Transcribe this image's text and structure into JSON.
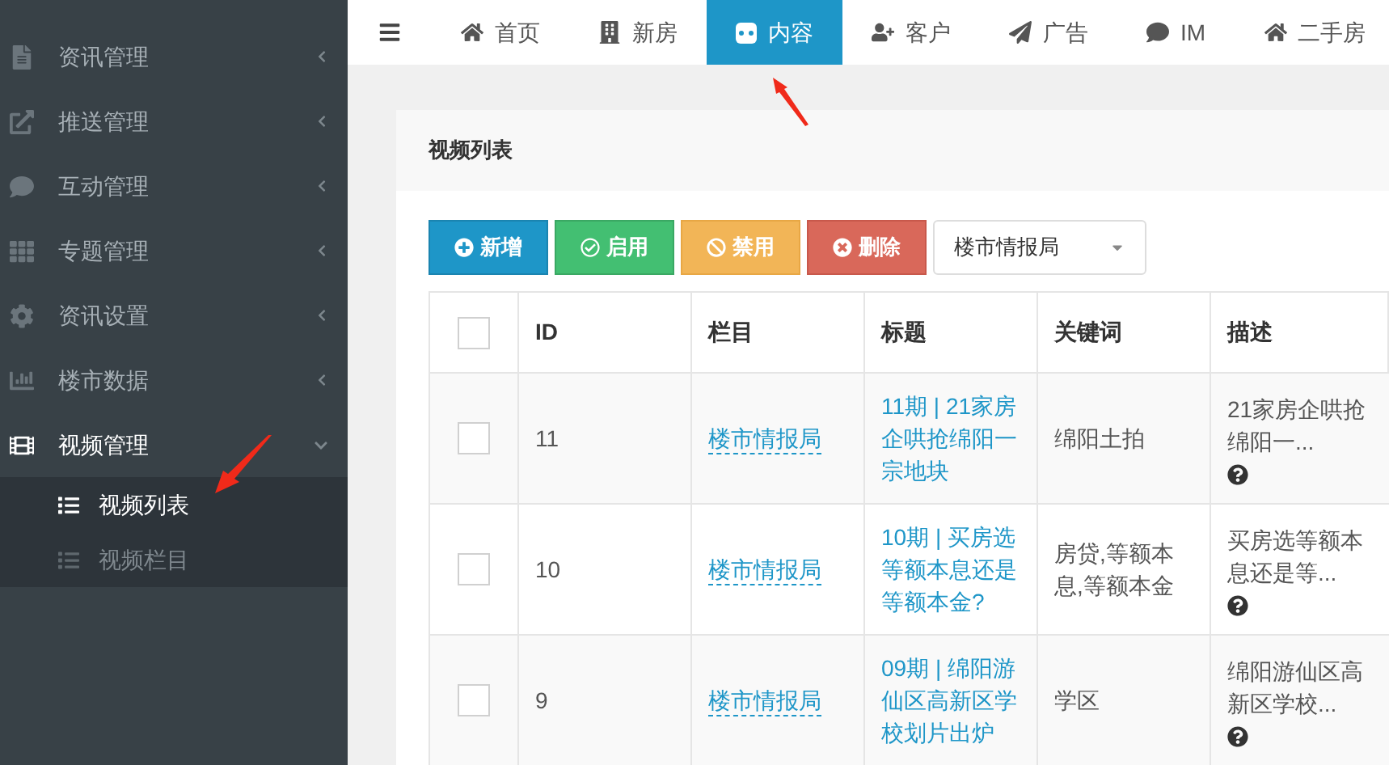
{
  "sidebar": {
    "items": [
      {
        "label": "资讯管理",
        "expanded": false
      },
      {
        "label": "推送管理",
        "expanded": false
      },
      {
        "label": "互动管理",
        "expanded": false
      },
      {
        "label": "专题管理",
        "expanded": false
      },
      {
        "label": "资讯设置",
        "expanded": false
      },
      {
        "label": "楼市数据",
        "expanded": false
      },
      {
        "label": "视频管理",
        "expanded": true,
        "children": [
          {
            "label": "视频列表",
            "selected": true
          },
          {
            "label": "视频栏目",
            "selected": false
          }
        ]
      }
    ]
  },
  "tabs": [
    {
      "label": "首页",
      "selected": false
    },
    {
      "label": "新房",
      "selected": false
    },
    {
      "label": "内容",
      "selected": true
    },
    {
      "label": "客户",
      "selected": false
    },
    {
      "label": "广告",
      "selected": false
    },
    {
      "label": "IM",
      "selected": false
    },
    {
      "label": "二手房",
      "selected": false
    }
  ],
  "panel": {
    "title": "视频列表",
    "buttons": [
      {
        "kind": "add",
        "label": "新增"
      },
      {
        "kind": "enable",
        "label": "启用"
      },
      {
        "kind": "disable",
        "label": "禁用"
      },
      {
        "kind": "delete",
        "label": "删除"
      }
    ],
    "filter": {
      "value": "楼市情报局"
    },
    "table": {
      "columns": [
        "ID",
        "栏目",
        "标题",
        "关键词",
        "描述"
      ],
      "header_checked": false,
      "rows": [
        {
          "checked": false,
          "id": "11",
          "category": "楼市情报局",
          "title": "11期 | 21家房企哄抢绵阳一宗地块",
          "keywords": "绵阳土拍",
          "description": "21家房企哄抢绵阳一..."
        },
        {
          "checked": false,
          "id": "10",
          "category": "楼市情报局",
          "title": "10期 | 买房选等额本息还是等额本金?",
          "keywords": "房贷,等额本息,等额本金",
          "description": "买房选等额本息还是等..."
        },
        {
          "checked": false,
          "id": "9",
          "category": "楼市情报局",
          "title": "09期 | 绵阳游仙区高新区学校划片出炉",
          "keywords": "学区",
          "description": "绵阳游仙区高新区学校..."
        }
      ]
    }
  }
}
